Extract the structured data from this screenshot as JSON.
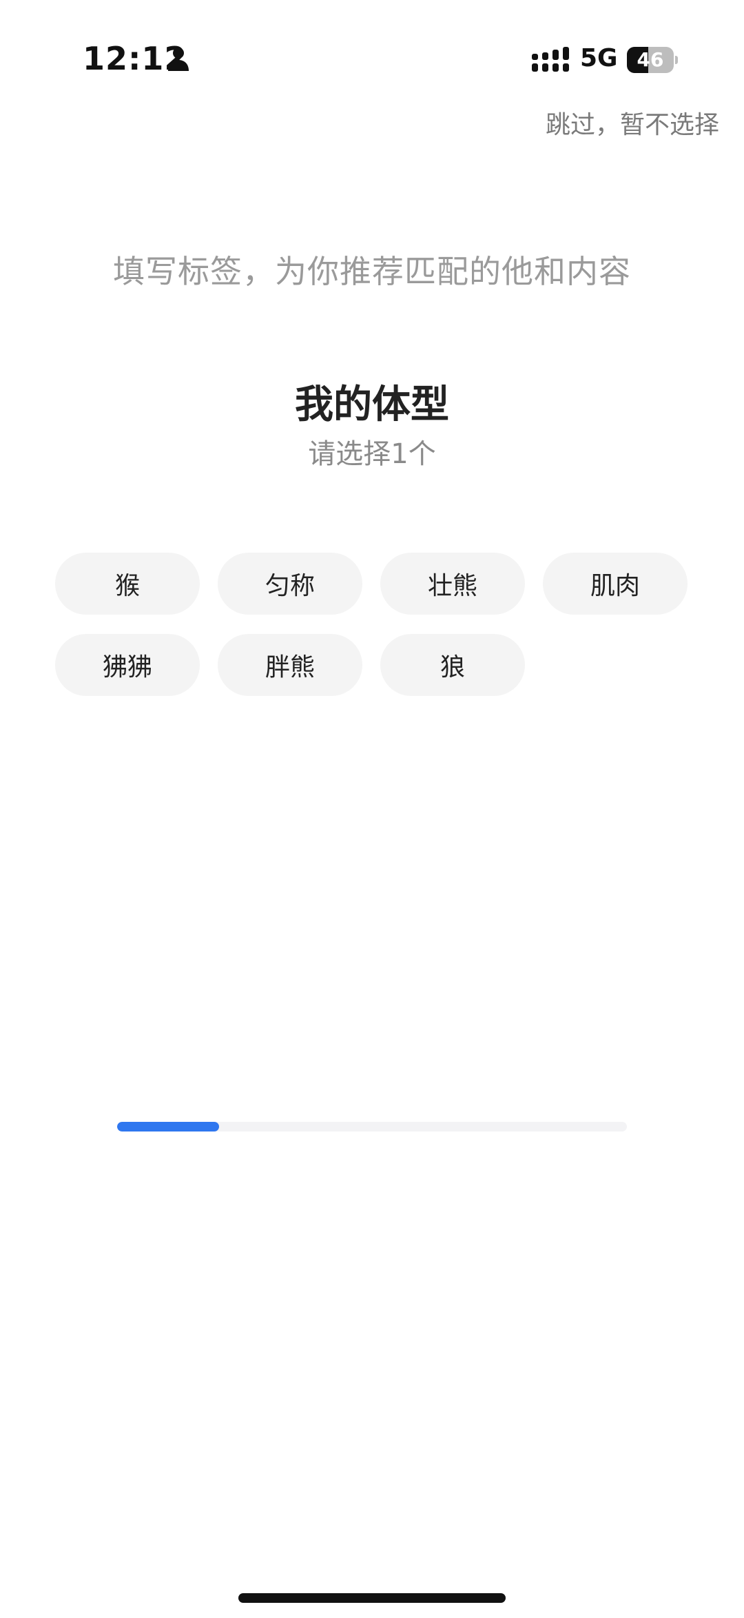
{
  "status_bar": {
    "time": "12:12",
    "network": "5G",
    "battery_level": "46",
    "battery_fraction": 0.46,
    "icons": [
      "person-icon",
      "signal-icon",
      "battery-icon"
    ]
  },
  "header": {
    "skip_label": "跳过，暂不选择"
  },
  "intro": {
    "text": "填写标签，为你推荐匹配的他和内容"
  },
  "section": {
    "title": "我的体型",
    "subtitle": "请选择1个"
  },
  "tags": [
    {
      "label": "猴"
    },
    {
      "label": "匀称"
    },
    {
      "label": "壮熊"
    },
    {
      "label": "肌肉"
    },
    {
      "label": "狒狒"
    },
    {
      "label": "胖熊"
    },
    {
      "label": "狼"
    }
  ],
  "progress": {
    "fraction": 0.2
  },
  "colors": {
    "accent": "#2f77ef",
    "chip_bg": "#f4f4f4",
    "muted_text": "#9a9a9a"
  }
}
